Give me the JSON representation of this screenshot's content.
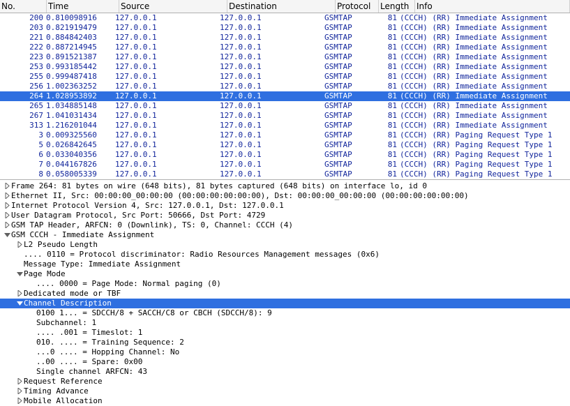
{
  "packet_list": {
    "columns": [
      "No.",
      "Time",
      "Source",
      "Destination",
      "Protocol",
      "Length",
      "Info"
    ],
    "selected_index": 8,
    "rows": [
      {
        "no": "200",
        "time": "0.810098916",
        "src": "127.0.0.1",
        "dst": "127.0.0.1",
        "prot": "GSMTAP",
        "len": "81",
        "info": "(CCCH) (RR) Immediate Assignment"
      },
      {
        "no": "203",
        "time": "0.821919479",
        "src": "127.0.0.1",
        "dst": "127.0.0.1",
        "prot": "GSMTAP",
        "len": "81",
        "info": "(CCCH) (RR) Immediate Assignment"
      },
      {
        "no": "221",
        "time": "0.884842403",
        "src": "127.0.0.1",
        "dst": "127.0.0.1",
        "prot": "GSMTAP",
        "len": "81",
        "info": "(CCCH) (RR) Immediate Assignment"
      },
      {
        "no": "222",
        "time": "0.887214945",
        "src": "127.0.0.1",
        "dst": "127.0.0.1",
        "prot": "GSMTAP",
        "len": "81",
        "info": "(CCCH) (RR) Immediate Assignment"
      },
      {
        "no": "223",
        "time": "0.891521387",
        "src": "127.0.0.1",
        "dst": "127.0.0.1",
        "prot": "GSMTAP",
        "len": "81",
        "info": "(CCCH) (RR) Immediate Assignment"
      },
      {
        "no": "253",
        "time": "0.993185442",
        "src": "127.0.0.1",
        "dst": "127.0.0.1",
        "prot": "GSMTAP",
        "len": "81",
        "info": "(CCCH) (RR) Immediate Assignment"
      },
      {
        "no": "255",
        "time": "0.999487418",
        "src": "127.0.0.1",
        "dst": "127.0.0.1",
        "prot": "GSMTAP",
        "len": "81",
        "info": "(CCCH) (RR) Immediate Assignment"
      },
      {
        "no": "256",
        "time": "1.002363252",
        "src": "127.0.0.1",
        "dst": "127.0.0.1",
        "prot": "GSMTAP",
        "len": "81",
        "info": "(CCCH) (RR) Immediate Assignment"
      },
      {
        "no": "264",
        "time": "1.028953892",
        "src": "127.0.0.1",
        "dst": "127.0.0.1",
        "prot": "GSMTAP",
        "len": "81",
        "info": "(CCCH) (RR) Immediate Assignment"
      },
      {
        "no": "265",
        "time": "1.034885148",
        "src": "127.0.0.1",
        "dst": "127.0.0.1",
        "prot": "GSMTAP",
        "len": "81",
        "info": "(CCCH) (RR) Immediate Assignment"
      },
      {
        "no": "267",
        "time": "1.041031434",
        "src": "127.0.0.1",
        "dst": "127.0.0.1",
        "prot": "GSMTAP",
        "len": "81",
        "info": "(CCCH) (RR) Immediate Assignment"
      },
      {
        "no": "313",
        "time": "1.216201044",
        "src": "127.0.0.1",
        "dst": "127.0.0.1",
        "prot": "GSMTAP",
        "len": "81",
        "info": "(CCCH) (RR) Immediate Assignment"
      },
      {
        "no": "3",
        "time": "0.009325560",
        "src": "127.0.0.1",
        "dst": "127.0.0.1",
        "prot": "GSMTAP",
        "len": "81",
        "info": "(CCCH) (RR) Paging Request Type 1"
      },
      {
        "no": "5",
        "time": "0.026842645",
        "src": "127.0.0.1",
        "dst": "127.0.0.1",
        "prot": "GSMTAP",
        "len": "81",
        "info": "(CCCH) (RR) Paging Request Type 1"
      },
      {
        "no": "6",
        "time": "0.033040356",
        "src": "127.0.0.1",
        "dst": "127.0.0.1",
        "prot": "GSMTAP",
        "len": "81",
        "info": "(CCCH) (RR) Paging Request Type 1"
      },
      {
        "no": "7",
        "time": "0.044167826",
        "src": "127.0.0.1",
        "dst": "127.0.0.1",
        "prot": "GSMTAP",
        "len": "81",
        "info": "(CCCH) (RR) Paging Request Type 1"
      },
      {
        "no": "8",
        "time": "0.058005339",
        "src": "127.0.0.1",
        "dst": "127.0.0.1",
        "prot": "GSMTAP",
        "len": "81",
        "info": "(CCCH) (RR) Paging Request Type 1"
      }
    ]
  },
  "details": {
    "selected_index": 12,
    "items": [
      {
        "indent": 0,
        "exp": "closed",
        "text": "Frame 264: 81 bytes on wire (648 bits), 81 bytes captured (648 bits) on interface lo, id 0"
      },
      {
        "indent": 0,
        "exp": "closed",
        "text": "Ethernet II, Src: 00:00:00_00:00:00 (00:00:00:00:00:00), Dst: 00:00:00_00:00:00 (00:00:00:00:00:00)"
      },
      {
        "indent": 0,
        "exp": "closed",
        "text": "Internet Protocol Version 4, Src: 127.0.0.1, Dst: 127.0.0.1"
      },
      {
        "indent": 0,
        "exp": "closed",
        "text": "User Datagram Protocol, Src Port: 50666, Dst Port: 4729"
      },
      {
        "indent": 0,
        "exp": "closed",
        "text": "GSM TAP Header, ARFCN: 0 (Downlink), TS: 0, Channel: CCCH (4)"
      },
      {
        "indent": 0,
        "exp": "open",
        "text": "GSM CCCH - Immediate Assignment"
      },
      {
        "indent": 1,
        "exp": "closed",
        "text": "L2 Pseudo Length"
      },
      {
        "indent": 1,
        "exp": "none",
        "text": ".... 0110 = Protocol discriminator: Radio Resources Management messages (0x6)"
      },
      {
        "indent": 1,
        "exp": "none",
        "text": "Message Type: Immediate Assignment"
      },
      {
        "indent": 1,
        "exp": "open",
        "text": "Page Mode"
      },
      {
        "indent": 2,
        "exp": "none",
        "text": ".... 0000 = Page Mode: Normal paging (0)"
      },
      {
        "indent": 1,
        "exp": "closed",
        "text": "Dedicated mode or TBF"
      },
      {
        "indent": 1,
        "exp": "open",
        "text": "Channel Description"
      },
      {
        "indent": 2,
        "exp": "none",
        "text": "0100 1... = SDCCH/8 + SACCH/C8 or CBCH (SDCCH/8): 9"
      },
      {
        "indent": 2,
        "exp": "none",
        "text": "Subchannel: 1"
      },
      {
        "indent": 2,
        "exp": "none",
        "text": ".... .001 = Timeslot: 1"
      },
      {
        "indent": 2,
        "exp": "none",
        "text": "010. .... = Training Sequence: 2"
      },
      {
        "indent": 2,
        "exp": "none",
        "text": "...0 .... = Hopping Channel: No"
      },
      {
        "indent": 2,
        "exp": "none",
        "text": "..00 .... = Spare: 0x00"
      },
      {
        "indent": 2,
        "exp": "none",
        "text": "Single channel ARFCN: 43"
      },
      {
        "indent": 1,
        "exp": "closed",
        "text": "Request Reference"
      },
      {
        "indent": 1,
        "exp": "closed",
        "text": "Timing Advance"
      },
      {
        "indent": 1,
        "exp": "closed",
        "text": "Mobile Allocation"
      }
    ]
  }
}
